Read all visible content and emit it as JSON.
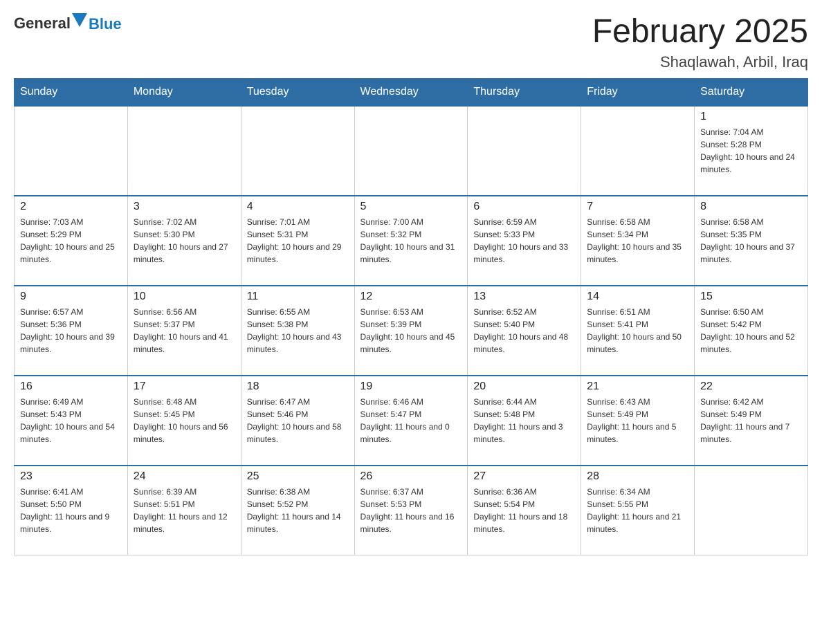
{
  "header": {
    "logo_text": "General",
    "logo_blue": "Blue",
    "month_title": "February 2025",
    "location": "Shaqlawah, Arbil, Iraq"
  },
  "weekdays": [
    "Sunday",
    "Monday",
    "Tuesday",
    "Wednesday",
    "Thursday",
    "Friday",
    "Saturday"
  ],
  "weeks": [
    [
      {
        "day": "",
        "sunrise": "",
        "sunset": "",
        "daylight": ""
      },
      {
        "day": "",
        "sunrise": "",
        "sunset": "",
        "daylight": ""
      },
      {
        "day": "",
        "sunrise": "",
        "sunset": "",
        "daylight": ""
      },
      {
        "day": "",
        "sunrise": "",
        "sunset": "",
        "daylight": ""
      },
      {
        "day": "",
        "sunrise": "",
        "sunset": "",
        "daylight": ""
      },
      {
        "day": "",
        "sunrise": "",
        "sunset": "",
        "daylight": ""
      },
      {
        "day": "1",
        "sunrise": "Sunrise: 7:04 AM",
        "sunset": "Sunset: 5:28 PM",
        "daylight": "Daylight: 10 hours and 24 minutes."
      }
    ],
    [
      {
        "day": "2",
        "sunrise": "Sunrise: 7:03 AM",
        "sunset": "Sunset: 5:29 PM",
        "daylight": "Daylight: 10 hours and 25 minutes."
      },
      {
        "day": "3",
        "sunrise": "Sunrise: 7:02 AM",
        "sunset": "Sunset: 5:30 PM",
        "daylight": "Daylight: 10 hours and 27 minutes."
      },
      {
        "day": "4",
        "sunrise": "Sunrise: 7:01 AM",
        "sunset": "Sunset: 5:31 PM",
        "daylight": "Daylight: 10 hours and 29 minutes."
      },
      {
        "day": "5",
        "sunrise": "Sunrise: 7:00 AM",
        "sunset": "Sunset: 5:32 PM",
        "daylight": "Daylight: 10 hours and 31 minutes."
      },
      {
        "day": "6",
        "sunrise": "Sunrise: 6:59 AM",
        "sunset": "Sunset: 5:33 PM",
        "daylight": "Daylight: 10 hours and 33 minutes."
      },
      {
        "day": "7",
        "sunrise": "Sunrise: 6:58 AM",
        "sunset": "Sunset: 5:34 PM",
        "daylight": "Daylight: 10 hours and 35 minutes."
      },
      {
        "day": "8",
        "sunrise": "Sunrise: 6:58 AM",
        "sunset": "Sunset: 5:35 PM",
        "daylight": "Daylight: 10 hours and 37 minutes."
      }
    ],
    [
      {
        "day": "9",
        "sunrise": "Sunrise: 6:57 AM",
        "sunset": "Sunset: 5:36 PM",
        "daylight": "Daylight: 10 hours and 39 minutes."
      },
      {
        "day": "10",
        "sunrise": "Sunrise: 6:56 AM",
        "sunset": "Sunset: 5:37 PM",
        "daylight": "Daylight: 10 hours and 41 minutes."
      },
      {
        "day": "11",
        "sunrise": "Sunrise: 6:55 AM",
        "sunset": "Sunset: 5:38 PM",
        "daylight": "Daylight: 10 hours and 43 minutes."
      },
      {
        "day": "12",
        "sunrise": "Sunrise: 6:53 AM",
        "sunset": "Sunset: 5:39 PM",
        "daylight": "Daylight: 10 hours and 45 minutes."
      },
      {
        "day": "13",
        "sunrise": "Sunrise: 6:52 AM",
        "sunset": "Sunset: 5:40 PM",
        "daylight": "Daylight: 10 hours and 48 minutes."
      },
      {
        "day": "14",
        "sunrise": "Sunrise: 6:51 AM",
        "sunset": "Sunset: 5:41 PM",
        "daylight": "Daylight: 10 hours and 50 minutes."
      },
      {
        "day": "15",
        "sunrise": "Sunrise: 6:50 AM",
        "sunset": "Sunset: 5:42 PM",
        "daylight": "Daylight: 10 hours and 52 minutes."
      }
    ],
    [
      {
        "day": "16",
        "sunrise": "Sunrise: 6:49 AM",
        "sunset": "Sunset: 5:43 PM",
        "daylight": "Daylight: 10 hours and 54 minutes."
      },
      {
        "day": "17",
        "sunrise": "Sunrise: 6:48 AM",
        "sunset": "Sunset: 5:45 PM",
        "daylight": "Daylight: 10 hours and 56 minutes."
      },
      {
        "day": "18",
        "sunrise": "Sunrise: 6:47 AM",
        "sunset": "Sunset: 5:46 PM",
        "daylight": "Daylight: 10 hours and 58 minutes."
      },
      {
        "day": "19",
        "sunrise": "Sunrise: 6:46 AM",
        "sunset": "Sunset: 5:47 PM",
        "daylight": "Daylight: 11 hours and 0 minutes."
      },
      {
        "day": "20",
        "sunrise": "Sunrise: 6:44 AM",
        "sunset": "Sunset: 5:48 PM",
        "daylight": "Daylight: 11 hours and 3 minutes."
      },
      {
        "day": "21",
        "sunrise": "Sunrise: 6:43 AM",
        "sunset": "Sunset: 5:49 PM",
        "daylight": "Daylight: 11 hours and 5 minutes."
      },
      {
        "day": "22",
        "sunrise": "Sunrise: 6:42 AM",
        "sunset": "Sunset: 5:49 PM",
        "daylight": "Daylight: 11 hours and 7 minutes."
      }
    ],
    [
      {
        "day": "23",
        "sunrise": "Sunrise: 6:41 AM",
        "sunset": "Sunset: 5:50 PM",
        "daylight": "Daylight: 11 hours and 9 minutes."
      },
      {
        "day": "24",
        "sunrise": "Sunrise: 6:39 AM",
        "sunset": "Sunset: 5:51 PM",
        "daylight": "Daylight: 11 hours and 12 minutes."
      },
      {
        "day": "25",
        "sunrise": "Sunrise: 6:38 AM",
        "sunset": "Sunset: 5:52 PM",
        "daylight": "Daylight: 11 hours and 14 minutes."
      },
      {
        "day": "26",
        "sunrise": "Sunrise: 6:37 AM",
        "sunset": "Sunset: 5:53 PM",
        "daylight": "Daylight: 11 hours and 16 minutes."
      },
      {
        "day": "27",
        "sunrise": "Sunrise: 6:36 AM",
        "sunset": "Sunset: 5:54 PM",
        "daylight": "Daylight: 11 hours and 18 minutes."
      },
      {
        "day": "28",
        "sunrise": "Sunrise: 6:34 AM",
        "sunset": "Sunset: 5:55 PM",
        "daylight": "Daylight: 11 hours and 21 minutes."
      },
      {
        "day": "",
        "sunrise": "",
        "sunset": "",
        "daylight": ""
      }
    ]
  ]
}
